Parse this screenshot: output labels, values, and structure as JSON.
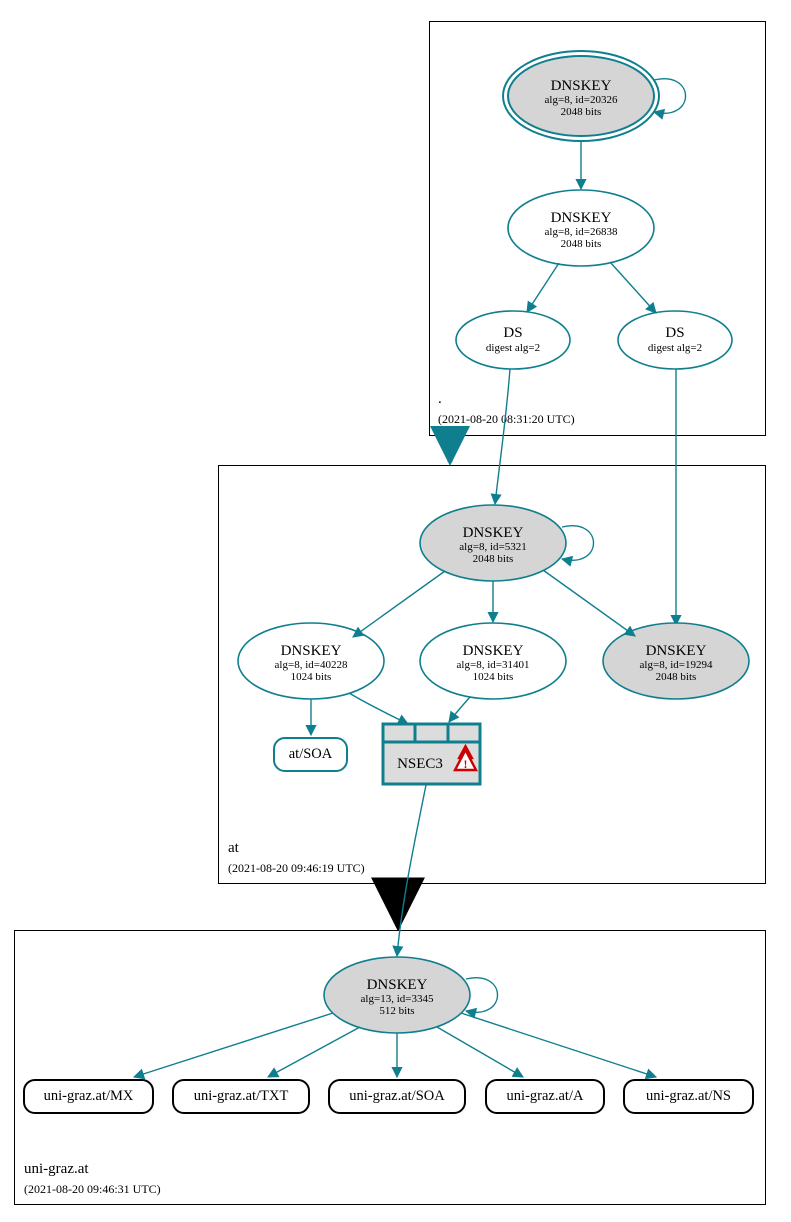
{
  "colors": {
    "teal": "#0f7f8f",
    "gray_fill": "#d5d5d5",
    "nsec_fill": "#dcdcdc"
  },
  "zones": {
    "root": {
      "name": ".",
      "timestamp": "(2021-08-20 08:31:20 UTC)"
    },
    "at": {
      "name": "at",
      "timestamp": "(2021-08-20 09:46:19 UTC)"
    },
    "leaf": {
      "name": "uni-graz.at",
      "timestamp": "(2021-08-20 09:46:31 UTC)"
    }
  },
  "nodes": {
    "root_ksk": {
      "title": "DNSKEY",
      "line2": "alg=8, id=20326",
      "line3": "2048 bits"
    },
    "root_zsk": {
      "title": "DNSKEY",
      "line2": "alg=8, id=26838",
      "line3": "2048 bits"
    },
    "root_ds1": {
      "title": "DS",
      "line2": "digest alg=2"
    },
    "root_ds2": {
      "title": "DS",
      "line2": "digest alg=2"
    },
    "at_ksk": {
      "title": "DNSKEY",
      "line2": "alg=8, id=5321",
      "line3": "2048 bits"
    },
    "at_zsk1": {
      "title": "DNSKEY",
      "line2": "alg=8, id=40228",
      "line3": "1024 bits"
    },
    "at_zsk2": {
      "title": "DNSKEY",
      "line2": "alg=8, id=31401",
      "line3": "1024 bits"
    },
    "at_key3": {
      "title": "DNSKEY",
      "line2": "alg=8, id=19294",
      "line3": "2048 bits"
    },
    "at_soa": {
      "label": "at/SOA"
    },
    "nsec3": {
      "label": "NSEC3"
    },
    "leaf_key": {
      "title": "DNSKEY",
      "line2": "alg=13, id=3345",
      "line3": "512 bits"
    },
    "leaf_mx": {
      "label": "uni-graz.at/MX"
    },
    "leaf_txt": {
      "label": "uni-graz.at/TXT"
    },
    "leaf_soa": {
      "label": "uni-graz.at/SOA"
    },
    "leaf_a": {
      "label": "uni-graz.at/A"
    },
    "leaf_ns": {
      "label": "uni-graz.at/NS"
    }
  },
  "chart_data": {
    "type": "diagram",
    "description": "DNSSEC authentication chain / DNSViz graph",
    "zones": [
      {
        "zone": ".",
        "timestamp": "2021-08-20 08:31:20 UTC",
        "records": [
          {
            "type": "DNSKEY",
            "alg": 8,
            "id": 20326,
            "bits": 2048,
            "role": "KSK (trust anchor)",
            "filled": true,
            "double_ring": true
          },
          {
            "type": "DNSKEY",
            "alg": 8,
            "id": 26838,
            "bits": 2048
          },
          {
            "type": "DS",
            "digest_alg": 2
          },
          {
            "type": "DS",
            "digest_alg": 2
          }
        ]
      },
      {
        "zone": "at",
        "timestamp": "2021-08-20 09:46:19 UTC",
        "records": [
          {
            "type": "DNSKEY",
            "alg": 8,
            "id": 5321,
            "bits": 2048,
            "filled": true
          },
          {
            "type": "DNSKEY",
            "alg": 8,
            "id": 40228,
            "bits": 1024
          },
          {
            "type": "DNSKEY",
            "alg": 8,
            "id": 31401,
            "bits": 1024
          },
          {
            "type": "DNSKEY",
            "alg": 8,
            "id": 19294,
            "bits": 2048,
            "filled": true
          },
          {
            "type": "SOA",
            "owner": "at"
          },
          {
            "type": "NSEC3",
            "warning": true
          }
        ]
      },
      {
        "zone": "uni-graz.at",
        "timestamp": "2021-08-20 09:46:31 UTC",
        "records": [
          {
            "type": "DNSKEY",
            "alg": 13,
            "id": 3345,
            "bits": 512,
            "filled": true
          },
          {
            "type": "MX",
            "owner": "uni-graz.at"
          },
          {
            "type": "TXT",
            "owner": "uni-graz.at"
          },
          {
            "type": "SOA",
            "owner": "uni-graz.at"
          },
          {
            "type": "A",
            "owner": "uni-graz.at"
          },
          {
            "type": "NS",
            "owner": "uni-graz.at"
          }
        ]
      }
    ],
    "edges": [
      {
        "from": "./DNSKEY/20326",
        "to": "./DNSKEY/20326",
        "kind": "self-sign"
      },
      {
        "from": "./DNSKEY/20326",
        "to": "./DNSKEY/26838"
      },
      {
        "from": "./DNSKEY/26838",
        "to": "./DS(1)"
      },
      {
        "from": "./DNSKEY/26838",
        "to": "./DS(2)"
      },
      {
        "from": "./DS(1)",
        "to": "at/DNSKEY/5321"
      },
      {
        "from": "./DS(2)",
        "to": "at/DNSKEY/19294"
      },
      {
        "from": ". zone",
        "to": "at zone",
        "kind": "delegation"
      },
      {
        "from": "at/DNSKEY/5321",
        "to": "at/DNSKEY/5321",
        "kind": "self-sign"
      },
      {
        "from": "at/DNSKEY/5321",
        "to": "at/DNSKEY/40228"
      },
      {
        "from": "at/DNSKEY/5321",
        "to": "at/DNSKEY/31401"
      },
      {
        "from": "at/DNSKEY/5321",
        "to": "at/DNSKEY/19294"
      },
      {
        "from": "at/DNSKEY/40228",
        "to": "at/SOA"
      },
      {
        "from": "at/DNSKEY/40228",
        "to": "NSEC3"
      },
      {
        "from": "at/DNSKEY/31401",
        "to": "NSEC3"
      },
      {
        "from": "NSEC3",
        "to": "uni-graz.at/DNSKEY/3345"
      },
      {
        "from": "at zone",
        "to": "uni-graz.at zone",
        "kind": "delegation"
      },
      {
        "from": "uni-graz.at/DNSKEY/3345",
        "to": "uni-graz.at/DNSKEY/3345",
        "kind": "self-sign"
      },
      {
        "from": "uni-graz.at/DNSKEY/3345",
        "to": "uni-graz.at/MX"
      },
      {
        "from": "uni-graz.at/DNSKEY/3345",
        "to": "uni-graz.at/TXT"
      },
      {
        "from": "uni-graz.at/DNSKEY/3345",
        "to": "uni-graz.at/SOA"
      },
      {
        "from": "uni-graz.at/DNSKEY/3345",
        "to": "uni-graz.at/A"
      },
      {
        "from": "uni-graz.at/DNSKEY/3345",
        "to": "uni-graz.at/NS"
      }
    ]
  }
}
